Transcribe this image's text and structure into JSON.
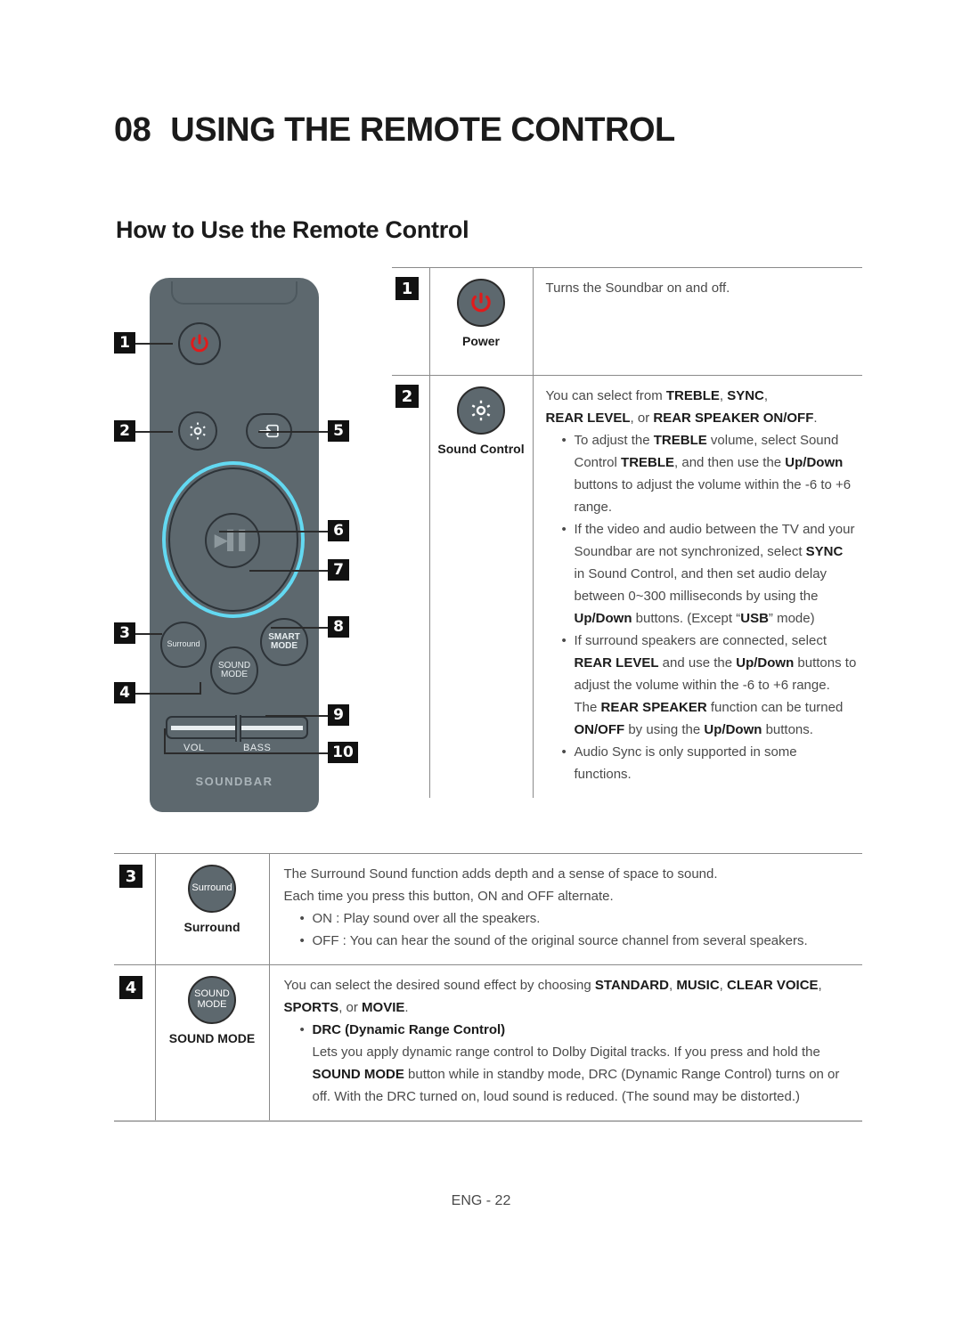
{
  "chapter": {
    "number": "08",
    "title": "USING THE REMOTE CONTROL"
  },
  "section": {
    "title": "How to Use the Remote Control"
  },
  "footer": {
    "page_label": "ENG - 22"
  },
  "colors": {
    "remote_body": "#5d686e",
    "ring_cyan": "#63d9f2",
    "power_red": "#e01b1b",
    "badge_black": "#111111",
    "rule_gray": "#8a8a8a"
  },
  "remote": {
    "brand_label": "SOUNDBAR",
    "slider_labels": {
      "vol": "VOL",
      "bass": "BASS"
    },
    "buttons": {
      "surround": "Surround",
      "smart_mode_line1": "SMART",
      "smart_mode_line2": "MODE",
      "sound_mode_line1": "SOUND",
      "sound_mode_line2": "MODE"
    },
    "callouts": [
      "1",
      "2",
      "3",
      "4",
      "5",
      "6",
      "7",
      "8",
      "9",
      "10"
    ]
  },
  "table": {
    "rows": [
      {
        "num": "1",
        "icon": "power-icon",
        "caption": "Power",
        "desc_lines": [
          "Turns the Soundbar on and off."
        ]
      },
      {
        "num": "2",
        "icon": "gear-icon",
        "caption": "Sound Control",
        "intro_a": "You can select from ",
        "intro_b": "TREBLE",
        "intro_c": ", ",
        "intro_d": "SYNC",
        "intro_e": ",",
        "intro_f": "REAR LEVEL",
        "intro_g": ", or ",
        "intro_h": "REAR SPEAKER ON/OFF",
        "intro_i": ".",
        "bullets": [
          "To adjust the TREBLE volume, select Sound Control TREBLE, and then use the Up/Down buttons to adjust the volume within the -6 to +6 range.",
          "If the video and audio between the TV and your Soundbar are not synchronized, select SYNC in Sound Control, and then set audio delay between 0~300 milliseconds by using the Up/Down buttons. (Except “USB” mode)",
          "If surround speakers are connected, select REAR LEVEL and use the Up/Down buttons to adjust the volume within the -6 to +6 range. The REAR SPEAKER function can be turned ON/OFF by using the Up/Down buttons.",
          "Audio Sync is only supported in some functions."
        ]
      },
      {
        "num": "3",
        "icon": "surround-icon",
        "icon_text": "Surround",
        "caption": "Surround",
        "line1": "The Surround Sound function adds depth and a sense of space to sound.",
        "line2": "Each time you press this button, ON and OFF alternate.",
        "bullets": [
          "ON : Play sound over all the speakers.",
          "OFF : You can hear the sound of the original source channel from several speakers."
        ]
      },
      {
        "num": "4",
        "icon": "sound-mode-icon",
        "icon_text_line1": "SOUND",
        "icon_text_line2": "MODE",
        "caption": "SOUND MODE",
        "intro_a": "You can select the desired sound effect by choosing ",
        "intro_b": "STANDARD",
        "intro_c": ", ",
        "intro_d": "MUSIC",
        "intro_e": ", ",
        "intro_f": "CLEAR VOICE",
        "intro_g": ", ",
        "intro_h": "SPORTS",
        "intro_i": ", or ",
        "intro_j": "MOVIE",
        "intro_k": ".",
        "drc_title": "DRC (Dynamic Range Control)",
        "drc_body_1": "Lets you apply dynamic range control to Dolby Digital tracks. If you press and hold the ",
        "drc_body_bold": "SOUND MODE",
        "drc_body_2": " button while in standby mode, DRC (Dynamic Range Control) turns on or off. With the DRC turned on, loud sound is reduced. (The sound may be distorted.)"
      }
    ]
  }
}
